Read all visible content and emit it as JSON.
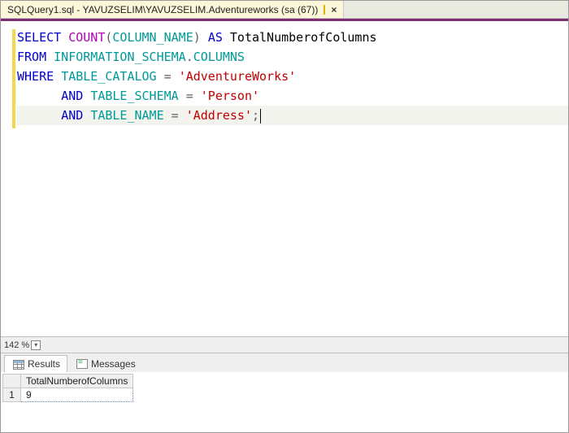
{
  "tab": {
    "label": "SQLQuery1.sql - YAVUZSELIM\\YAVUZSELIM.Adventureworks (sa (67))"
  },
  "sql": {
    "kw_select": "SELECT",
    "fn_count": "COUNT",
    "paren_open": "(",
    "col": "COLUMN_NAME",
    "paren_close": ")",
    "kw_as": "AS",
    "alias": "TotalNumberofColumns",
    "kw_from": "FROM",
    "schema": "INFORMATION_SCHEMA",
    "dot": ".",
    "view": "COLUMNS",
    "kw_where": "WHERE",
    "tcat": "TABLE_CATALOG",
    "eq": "=",
    "val_cat": "'AdventureWorks'",
    "kw_and1": "AND",
    "tschema": "TABLE_SCHEMA",
    "val_schema": "'Person'",
    "kw_and2": "AND",
    "tname": "TABLE_NAME",
    "val_name": "'Address'",
    "semi": ";"
  },
  "zoom": {
    "value": "142 %"
  },
  "result_tabs": {
    "results": "Results",
    "messages": "Messages"
  },
  "results": {
    "header_blank": "",
    "col1": "TotalNumberofColumns",
    "row1_num": "1",
    "row1_val": "9"
  }
}
